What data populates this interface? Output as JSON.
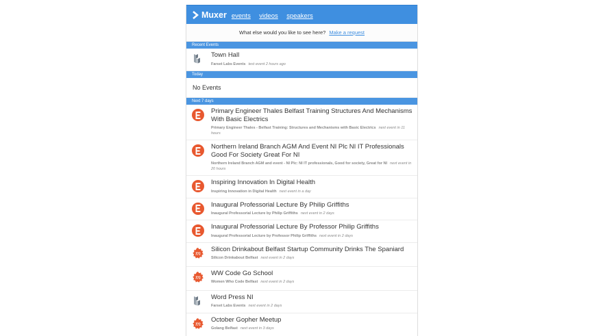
{
  "app": {
    "brand": "Muxer",
    "nav": [
      "events",
      "videos",
      "speakers"
    ]
  },
  "request": {
    "text": "What else would you like to see here?",
    "link": "Make a request"
  },
  "sections": {
    "recent": {
      "title": "Recent Events",
      "events": [
        {
          "title": "Town Hall",
          "group": "Farset Labs Events",
          "when": "test event 2 hours ago",
          "icon": "farset-logo-icon"
        }
      ]
    },
    "today": {
      "title": "Today",
      "empty": "No Events"
    },
    "next7": {
      "title": "Next 7 days",
      "events": [
        {
          "title": "Primary Engineer Thales Belfast Training Structures And Mechanisms With Basic Electrics",
          "group": "Primary Engineer Thales - Belfast Training: Structures and Mechanisms with Basic Electrics",
          "when": "next event in 11 hours",
          "icon": "eventbrite-icon"
        },
        {
          "title": "Northern Ireland Branch AGM And Event NI Plc NI IT Professionals Good For Society Great For NI",
          "group": "Northern Ireland Branch AGM and event - NI Plc: NI IT professionals, Good for society, Great for NI",
          "when": "next event in 20 hours",
          "icon": "eventbrite-icon"
        },
        {
          "title": "Inspiring Innovation In Digital Health",
          "group": "Inspiring Innovation in Digital Health",
          "when": "next event in a day",
          "icon": "eventbrite-icon"
        },
        {
          "title": "Inaugural Professorial Lecture By Philip Griffiths",
          "group": "Inaugural Professorial Lecture by Philip Griffiths",
          "when": "next event in 2 days",
          "icon": "eventbrite-icon"
        },
        {
          "title": "Inaugural Professorial Lecture By Professor Philip Griffiths",
          "group": "Inaugural Professorial Lecture by Professor Philip Griffiths",
          "when": "next event in 2 days",
          "icon": "eventbrite-icon"
        },
        {
          "title": "Silicon Drinkabout Belfast Startup Community Drinks The Spaniard",
          "group": "Silicon Drinkabout Belfast",
          "when": "next event in 2 days",
          "icon": "meetup-icon"
        },
        {
          "title": "WW Code Go School",
          "group": "Women Who Code Belfast",
          "when": "next event in 2 days",
          "icon": "meetup-icon"
        },
        {
          "title": "Word Press NI",
          "group": "Farset Labs Events",
          "when": "next event in 2 days",
          "icon": "farset-logo-icon"
        },
        {
          "title": "October Gopher Meetup",
          "group": "Golang Belfast",
          "when": "next event in 3 days",
          "icon": "meetup-icon"
        }
      ]
    }
  }
}
